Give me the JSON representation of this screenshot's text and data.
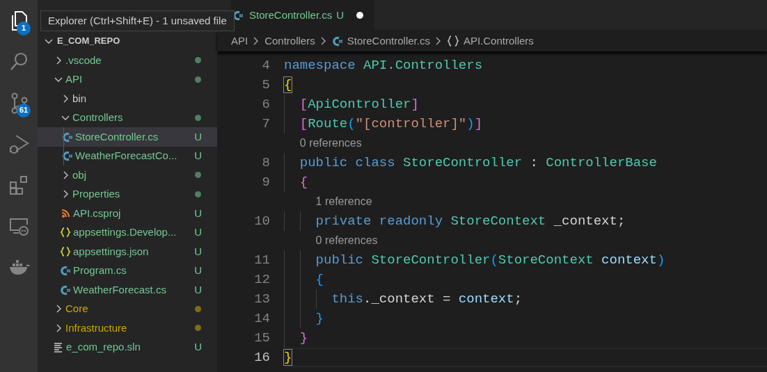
{
  "activity_bar": {
    "items": [
      {
        "kind": "files",
        "selected": true,
        "badge": "1"
      },
      {
        "kind": "search",
        "selected": false
      },
      {
        "kind": "source_control",
        "selected": false,
        "badge": "61"
      },
      {
        "kind": "run_debug",
        "selected": false
      },
      {
        "kind": "extensions",
        "selected": false
      },
      {
        "kind": "remote",
        "selected": false
      },
      {
        "kind": "docker",
        "selected": false
      }
    ]
  },
  "tooltip": {
    "text": "Explorer (Ctrl+Shift+E) - 1 unsaved file"
  },
  "explorer": {
    "root": {
      "label": "E_COM_REPO",
      "expanded": true
    },
    "items": [
      {
        "kind": "folder",
        "label": ".vscode",
        "expanded": false,
        "color": "#73c991",
        "dot": true,
        "selected": false
      },
      {
        "kind": "folder",
        "label": "API",
        "expanded": true,
        "color": "#73c991",
        "dot": true,
        "selected": false,
        "children": [
          {
            "kind": "folder",
            "label": "bin",
            "expanded": false,
            "color": "#cccccc",
            "dot": false,
            "selected": false
          },
          {
            "kind": "folder",
            "label": "Controllers",
            "expanded": true,
            "color": "#73c991",
            "dot": true,
            "selected": false,
            "children": [
              {
                "kind": "csharp_file",
                "label": "StoreController.cs",
                "color": "#73c991",
                "badge": "U",
                "selected": true
              },
              {
                "kind": "csharp_file",
                "label": "WeatherForecastCo...",
                "color": "#73c991",
                "badge": "U",
                "selected": false
              }
            ]
          },
          {
            "kind": "folder",
            "label": "obj",
            "expanded": false,
            "color": "#73c991",
            "dot": true,
            "selected": false
          },
          {
            "kind": "folder",
            "label": "Properties",
            "expanded": false,
            "color": "#73c991",
            "dot": true,
            "selected": false
          },
          {
            "kind": "project_file",
            "label": "API.csproj",
            "color": "#73c991",
            "badge": "U",
            "selected": false
          },
          {
            "kind": "json_file",
            "label": "appsettings.Develop...",
            "color": "#73c991",
            "badge": "U",
            "selected": false
          },
          {
            "kind": "json_file",
            "label": "appsettings.json",
            "color": "#73c991",
            "badge": "U",
            "selected": false
          },
          {
            "kind": "csharp_file",
            "label": "Program.cs",
            "color": "#73c991",
            "badge": "U",
            "selected": false
          },
          {
            "kind": "csharp_file",
            "label": "WeatherForecast.cs",
            "color": "#73c991",
            "badge": "U",
            "selected": false
          }
        ]
      },
      {
        "kind": "folder",
        "label": "Core",
        "expanded": false,
        "color": "#cca700",
        "dot": true,
        "selected": false
      },
      {
        "kind": "folder",
        "label": "Infrastructure",
        "expanded": false,
        "color": "#cca700",
        "dot": true,
        "selected": false
      },
      {
        "kind": "solution_file",
        "label": "e_com_repo.sln",
        "color": "#73c991",
        "badge": "U",
        "selected": false
      }
    ]
  },
  "tabs": [
    {
      "label": "StoreController.cs",
      "badge": "U",
      "dirty": true,
      "selected": true
    }
  ],
  "breadcrumbs": [
    {
      "kind": "folder",
      "label": "API"
    },
    {
      "kind": "folder",
      "label": "Controllers"
    },
    {
      "kind": "csharp",
      "label": "StoreController.cs"
    },
    {
      "kind": "namespace",
      "label": "API.Controllers"
    }
  ],
  "code": [
    {
      "kind": "line",
      "number": "4",
      "current": false,
      "tokens": [
        {
          "kind": "keyword",
          "text": "namespace "
        },
        {
          "kind": "type",
          "text": "API.Controllers"
        }
      ]
    },
    {
      "kind": "line",
      "number": "5",
      "current": false,
      "tokens": [
        {
          "kind": "bracket1",
          "text": "{",
          "matched": true
        }
      ]
    },
    {
      "kind": "line",
      "number": "6",
      "current": false,
      "tokens": [
        {
          "kind": "bracket2",
          "text": "  ["
        },
        {
          "kind": "type",
          "text": "ApiController"
        },
        {
          "kind": "bracket2",
          "text": "]"
        }
      ]
    },
    {
      "kind": "line",
      "number": "7",
      "current": false,
      "tokens": [
        {
          "kind": "bracket2",
          "text": "  ["
        },
        {
          "kind": "type",
          "text": "Route"
        },
        {
          "kind": "bracket3",
          "text": "("
        },
        {
          "kind": "string",
          "text": "\"[controller]\""
        },
        {
          "kind": "bracket3",
          "text": ")"
        },
        {
          "kind": "bracket2",
          "text": "]"
        }
      ]
    },
    {
      "kind": "codelens",
      "text": "0 references"
    },
    {
      "kind": "line",
      "number": "8",
      "current": false,
      "tokens": [
        {
          "kind": "keyword",
          "text": "  public class "
        },
        {
          "kind": "type",
          "text": "StoreController"
        },
        {
          "kind": "plain",
          "text": " : "
        },
        {
          "kind": "type",
          "text": "ControllerBase"
        }
      ]
    },
    {
      "kind": "line",
      "number": "9",
      "current": false,
      "tokens": [
        {
          "kind": "bracket2",
          "text": "  {"
        }
      ]
    },
    {
      "kind": "codelens",
      "text": "1 reference"
    },
    {
      "kind": "line",
      "number": "10",
      "current": false,
      "tokens": [
        {
          "kind": "keyword",
          "text": "    private readonly "
        },
        {
          "kind": "type",
          "text": "StoreContext"
        },
        {
          "kind": "plain",
          "text": " _context;"
        }
      ]
    },
    {
      "kind": "codelens",
      "text": "0 references"
    },
    {
      "kind": "line",
      "number": "11",
      "current": false,
      "tokens": [
        {
          "kind": "keyword",
          "text": "    public "
        },
        {
          "kind": "type",
          "text": "StoreController"
        },
        {
          "kind": "bracket3",
          "text": "("
        },
        {
          "kind": "type",
          "text": "StoreContext "
        },
        {
          "kind": "variable",
          "text": "context"
        },
        {
          "kind": "bracket3",
          "text": ")"
        }
      ]
    },
    {
      "kind": "line",
      "number": "12",
      "current": false,
      "tokens": [
        {
          "kind": "bracket3",
          "text": "    {"
        }
      ]
    },
    {
      "kind": "line",
      "number": "13",
      "current": false,
      "tokens": [
        {
          "kind": "keyword",
          "text": "      this"
        },
        {
          "kind": "plain",
          "text": "._context = "
        },
        {
          "kind": "variable",
          "text": "context"
        },
        {
          "kind": "plain",
          "text": ";"
        }
      ]
    },
    {
      "kind": "line",
      "number": "14",
      "current": false,
      "tokens": [
        {
          "kind": "bracket3",
          "text": "    }"
        }
      ]
    },
    {
      "kind": "line",
      "number": "15",
      "current": false,
      "tokens": [
        {
          "kind": "bracket2",
          "text": "  }"
        }
      ]
    },
    {
      "kind": "line",
      "number": "16",
      "current": true,
      "tokens": [
        {
          "kind": "bracket1",
          "text": "}",
          "matched": true
        }
      ]
    }
  ]
}
